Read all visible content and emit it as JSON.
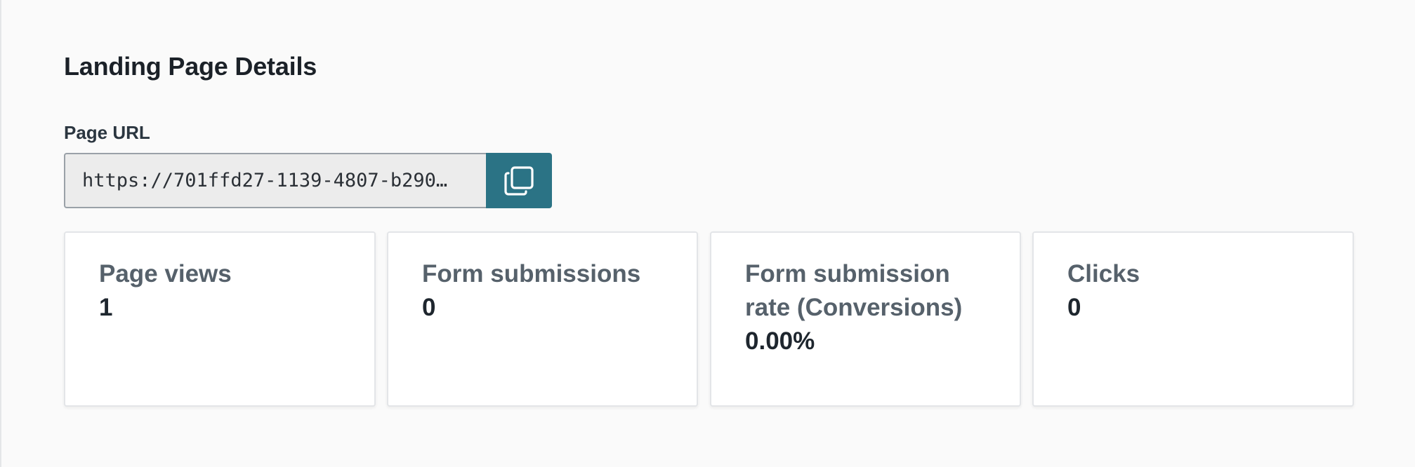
{
  "section": {
    "title": "Landing Page Details"
  },
  "url_field": {
    "label": "Page URL",
    "value": "https://701ffd27-1139-4807-b290…",
    "copy_icon": "copy-icon"
  },
  "stats": [
    {
      "label": "Page views",
      "value": "1"
    },
    {
      "label": "Form submissions",
      "value": "0"
    },
    {
      "label": "Form submission rate (Conversions)",
      "value": "0.00%"
    },
    {
      "label": "Clicks",
      "value": "0"
    }
  ],
  "colors": {
    "accent": "#2b7385",
    "card_border": "#e3e5e8",
    "input_bg": "#ececec",
    "label_text": "#56616b",
    "value_text": "#1e262e"
  }
}
